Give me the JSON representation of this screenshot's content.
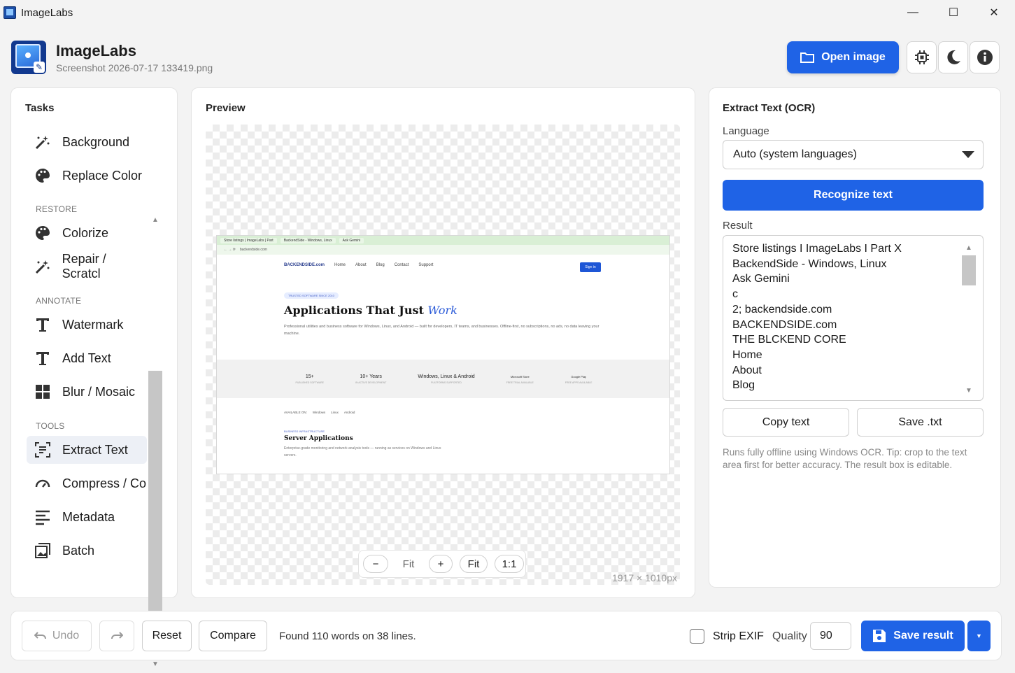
{
  "window": {
    "title": "ImageLabs",
    "controls": {
      "minimize": "—",
      "maximize": "☐",
      "close": "✕"
    }
  },
  "header": {
    "app_name": "ImageLabs",
    "file_name": "Screenshot 2026-07-17 133419.png",
    "open_label": "Open image",
    "icons": [
      "cpu-icon",
      "moon-icon",
      "info-icon"
    ]
  },
  "tasks": {
    "title": "Tasks",
    "groups": [
      {
        "label": "",
        "items": [
          {
            "label": "Background",
            "icon": "magic-wand-icon"
          },
          {
            "label": "Replace Color",
            "icon": "palette-icon"
          }
        ]
      },
      {
        "label": "RESTORE",
        "items": [
          {
            "label": "Colorize",
            "icon": "palette-icon"
          },
          {
            "label": "Repair / Scratcl",
            "icon": "magic-wand-icon"
          }
        ]
      },
      {
        "label": "ANNOTATE",
        "items": [
          {
            "label": "Watermark",
            "icon": "text-t-icon"
          },
          {
            "label": "Add Text",
            "icon": "text-t-icon"
          },
          {
            "label": "Blur / Mosaic",
            "icon": "grid-icon"
          }
        ]
      },
      {
        "label": "TOOLS",
        "items": [
          {
            "label": "Extract Text",
            "icon": "scan-text-icon",
            "active": true
          },
          {
            "label": "Compress / Co",
            "icon": "gauge-icon"
          },
          {
            "label": "Metadata",
            "icon": "lines-icon"
          },
          {
            "label": "Batch",
            "icon": "images-icon"
          }
        ]
      }
    ]
  },
  "preview": {
    "title": "Preview",
    "zoom": {
      "minus": "−",
      "fit_text": "Fit",
      "plus": "+",
      "fit_button": "Fit",
      "one_to_one": "1:1"
    },
    "dimensions": "1917 × 1010px",
    "screenshot": {
      "tab1": "Store listings | ImageLabs | Part",
      "tab2": "BackendSide - Windows, Linux",
      "tab3": "Ask Gemini",
      "address": "backendside.com",
      "logo": "BACKENDSIDE.com",
      "nav": [
        "Home",
        "About",
        "Blog",
        "Contact",
        "Support"
      ],
      "signin": "Sign in",
      "badge": "TRUSTED SOFTWARE SINCE 2010",
      "hero_a": "Applications That Just ",
      "hero_b": "Work",
      "sub": "Professional utilities and business software for Windows, Linux, and Android — built for developers, IT teams, and businesses. Offline-first, no subscriptions, no ads, no data leaving your machine.",
      "stats": [
        {
          "v": "15+",
          "s": "PUBLISHED SOFTWARE"
        },
        {
          "v": "10+ Years",
          "s": "IN ACTIVE DEVELOPMENT"
        },
        {
          "v": "Windows, Linux & Android",
          "s": "PLATFORMS SUPPORTED"
        },
        {
          "v": "Microsoft Store",
          "s": "FREE TRIAL AVAILABLE"
        },
        {
          "v": "Google Play",
          "s": "FREE APPS AVAILABLE"
        }
      ],
      "available": [
        "AVAILABLE ON:",
        "Windows",
        "Linux",
        "Android"
      ],
      "server_tag": "BUSINESS INFRASTRUCTURE",
      "server_title": "Server Applications",
      "server_sub": "Enterprise-grade monitoring and network analysis tools — running as services on Windows and Linux servers."
    }
  },
  "ocr": {
    "title": "Extract Text (OCR)",
    "language_label": "Language",
    "language_value": "Auto (system languages)",
    "recognize_label": "Recognize text",
    "result_label": "Result",
    "result_lines": [
      "Store listings I ImageLabs I Part X",
      "BackendSide - Windows, Linux",
      "Ask Gemini",
      "c",
      "2; backendside.com",
      "BACKENDSIDE.com",
      "THE BLCKEND CORE",
      "Home",
      "About",
      "Blog"
    ],
    "copy_label": "Copy text",
    "save_txt_label": "Save .txt",
    "tip": "Runs fully offline using Windows OCR. Tip: crop to the text area first for better accuracy. The result box is editable."
  },
  "bottom": {
    "undo_label": "Undo",
    "reset_label": "Reset",
    "compare_label": "Compare",
    "status": "Found 110 words on 38 lines.",
    "strip_exif_label": "Strip EXIF",
    "strip_exif_checked": false,
    "quality_label": "Quality",
    "quality_value": "90",
    "save_label": "Save result"
  },
  "colors": {
    "accent": "#1f63e6",
    "active_item_bg": "#edf0f6"
  }
}
